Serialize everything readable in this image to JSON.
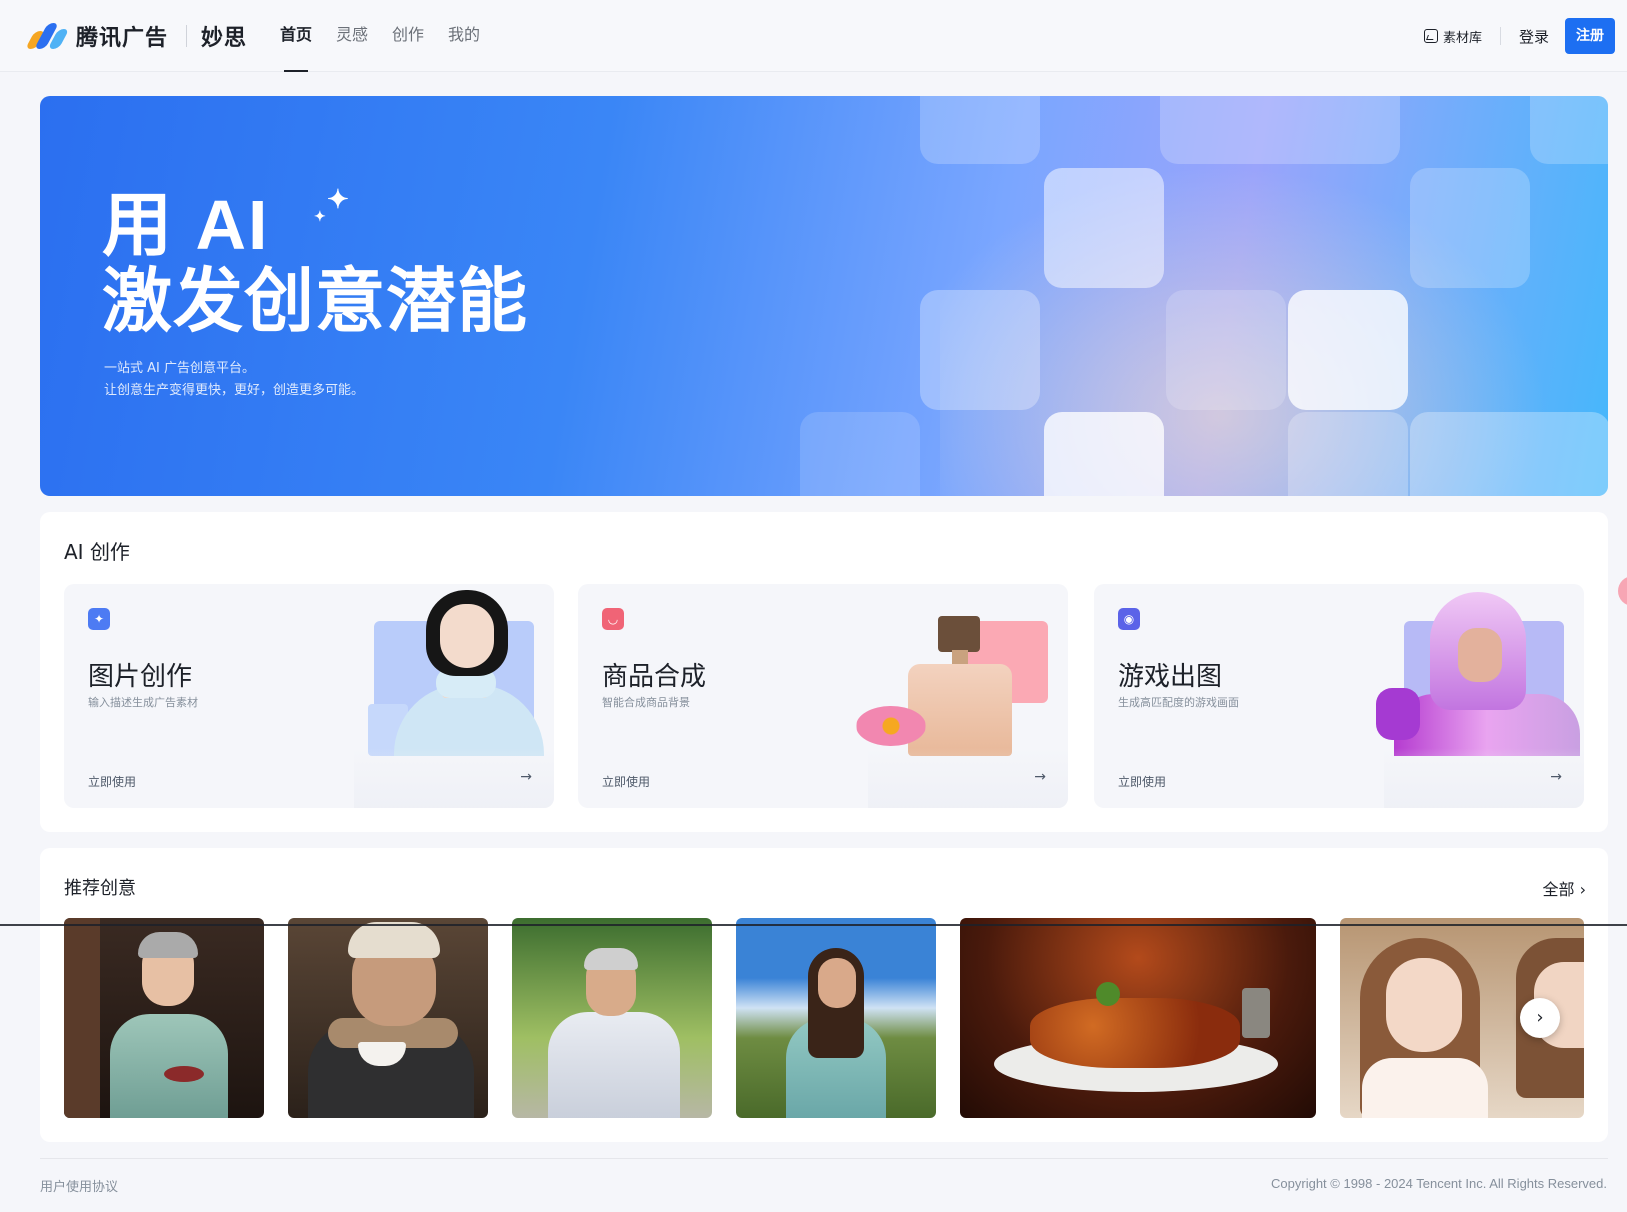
{
  "header": {
    "brand": "腾讯广告",
    "product": "妙思",
    "nav": [
      "首页",
      "灵感",
      "创作",
      "我的"
    ],
    "assets_label": "素材库",
    "login_label": "登录",
    "register_label": "注册"
  },
  "hero": {
    "title_line1": "用 AI",
    "title_line2": "激发创意潜能",
    "desc_line1": "一站式 AI 广告创意平台。",
    "desc_line2": "让创意生产变得更快，更好，创造更多可能。"
  },
  "ai_section": {
    "title": "AI 创作",
    "cards": [
      {
        "title": "图片创作",
        "subtitle": "输入描述生成广告素材",
        "cta": "立即使用",
        "icon": "sparkle-icon",
        "color": "#4d7bf3"
      },
      {
        "title": "商品合成",
        "subtitle": "智能合成商品背景",
        "cta": "立即使用",
        "icon": "bag-icon",
        "color": "#f06476"
      },
      {
        "title": "游戏出图",
        "subtitle": "生成高匹配度的游戏画面",
        "cta": "立即使用",
        "icon": "gamepad-icon",
        "color": "#5b63e8"
      }
    ]
  },
  "recommend": {
    "title": "推荐创意",
    "all_label": "全部"
  },
  "footer": {
    "agreement": "用户使用协议",
    "copyright": "Copyright © 1998 - 2024 Tencent Inc. All Rights Reserved."
  },
  "colors": {
    "accent": "#1d6ff2",
    "hero_start": "#2b6ff0",
    "hero_end": "#45b7fb"
  }
}
